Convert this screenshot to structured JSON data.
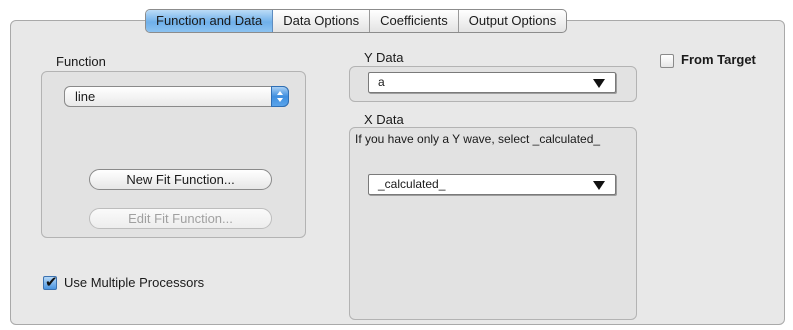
{
  "tabs": [
    {
      "label": "Function and Data",
      "active": true
    },
    {
      "label": "Data Options",
      "active": false
    },
    {
      "label": "Coefficients",
      "active": false
    },
    {
      "label": "Output Options",
      "active": false
    }
  ],
  "function_group": {
    "label": "Function",
    "selected": "line",
    "new_button": "New Fit Function...",
    "edit_button": "Edit Fit Function..."
  },
  "y_data": {
    "label": "Y Data",
    "selected": "a"
  },
  "x_data": {
    "label": "X Data",
    "hint": "If you have only a Y wave, select _calculated_",
    "selected": "_calculated_"
  },
  "from_target": {
    "label": "From Target",
    "checked": false
  },
  "multiple_processors": {
    "label": "Use Multiple Processors",
    "checked": true
  },
  "colors": {
    "accent": "#4b95e0",
    "pane": "#e8e8e8"
  }
}
